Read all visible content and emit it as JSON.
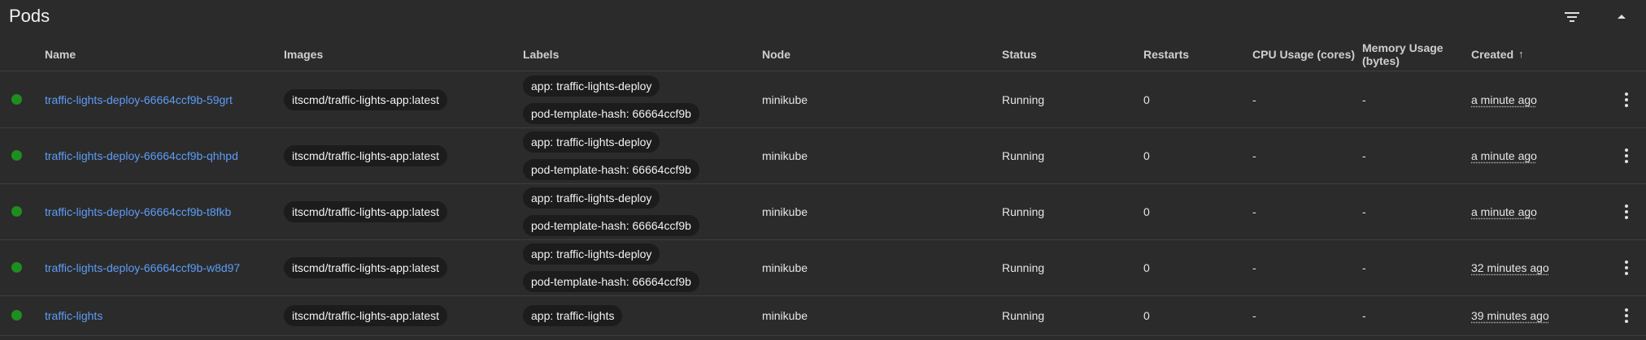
{
  "panel": {
    "title": "Pods",
    "filter_icon": "filter-icon",
    "collapse_icon": "collapse-icon"
  },
  "columns": {
    "name": "Name",
    "images": "Images",
    "labels": "Labels",
    "node": "Node",
    "status": "Status",
    "restarts": "Restarts",
    "cpu": "CPU Usage (cores)",
    "memory_line1": "Memory Usage",
    "memory_line2": "(bytes)",
    "created": "Created",
    "created_sort": "↑"
  },
  "colors": {
    "running_dot": "#1e8e1e",
    "link": "#5d9cf5"
  },
  "rows": [
    {
      "name": "traffic-lights-deploy-66664ccf9b-59grt",
      "image": "itscmd/traffic-lights-app:latest",
      "labels": [
        "app: traffic-lights-deploy",
        "pod-template-hash: 66664ccf9b"
      ],
      "node": "minikube",
      "status": "Running",
      "restarts": "0",
      "cpu": "-",
      "memory": "-",
      "created": "a minute ago"
    },
    {
      "name": "traffic-lights-deploy-66664ccf9b-qhhpd",
      "image": "itscmd/traffic-lights-app:latest",
      "labels": [
        "app: traffic-lights-deploy",
        "pod-template-hash: 66664ccf9b"
      ],
      "node": "minikube",
      "status": "Running",
      "restarts": "0",
      "cpu": "-",
      "memory": "-",
      "created": "a minute ago"
    },
    {
      "name": "traffic-lights-deploy-66664ccf9b-t8fkb",
      "image": "itscmd/traffic-lights-app:latest",
      "labels": [
        "app: traffic-lights-deploy",
        "pod-template-hash: 66664ccf9b"
      ],
      "node": "minikube",
      "status": "Running",
      "restarts": "0",
      "cpu": "-",
      "memory": "-",
      "created": "a minute ago"
    },
    {
      "name": "traffic-lights-deploy-66664ccf9b-w8d97",
      "image": "itscmd/traffic-lights-app:latest",
      "labels": [
        "app: traffic-lights-deploy",
        "pod-template-hash: 66664ccf9b"
      ],
      "node": "minikube",
      "status": "Running",
      "restarts": "0",
      "cpu": "-",
      "memory": "-",
      "created": "32 minutes ago"
    },
    {
      "name": "traffic-lights",
      "image": "itscmd/traffic-lights-app:latest",
      "labels": [
        "app: traffic-lights"
      ],
      "node": "minikube",
      "status": "Running",
      "restarts": "0",
      "cpu": "-",
      "memory": "-",
      "created": "39 minutes ago"
    }
  ]
}
